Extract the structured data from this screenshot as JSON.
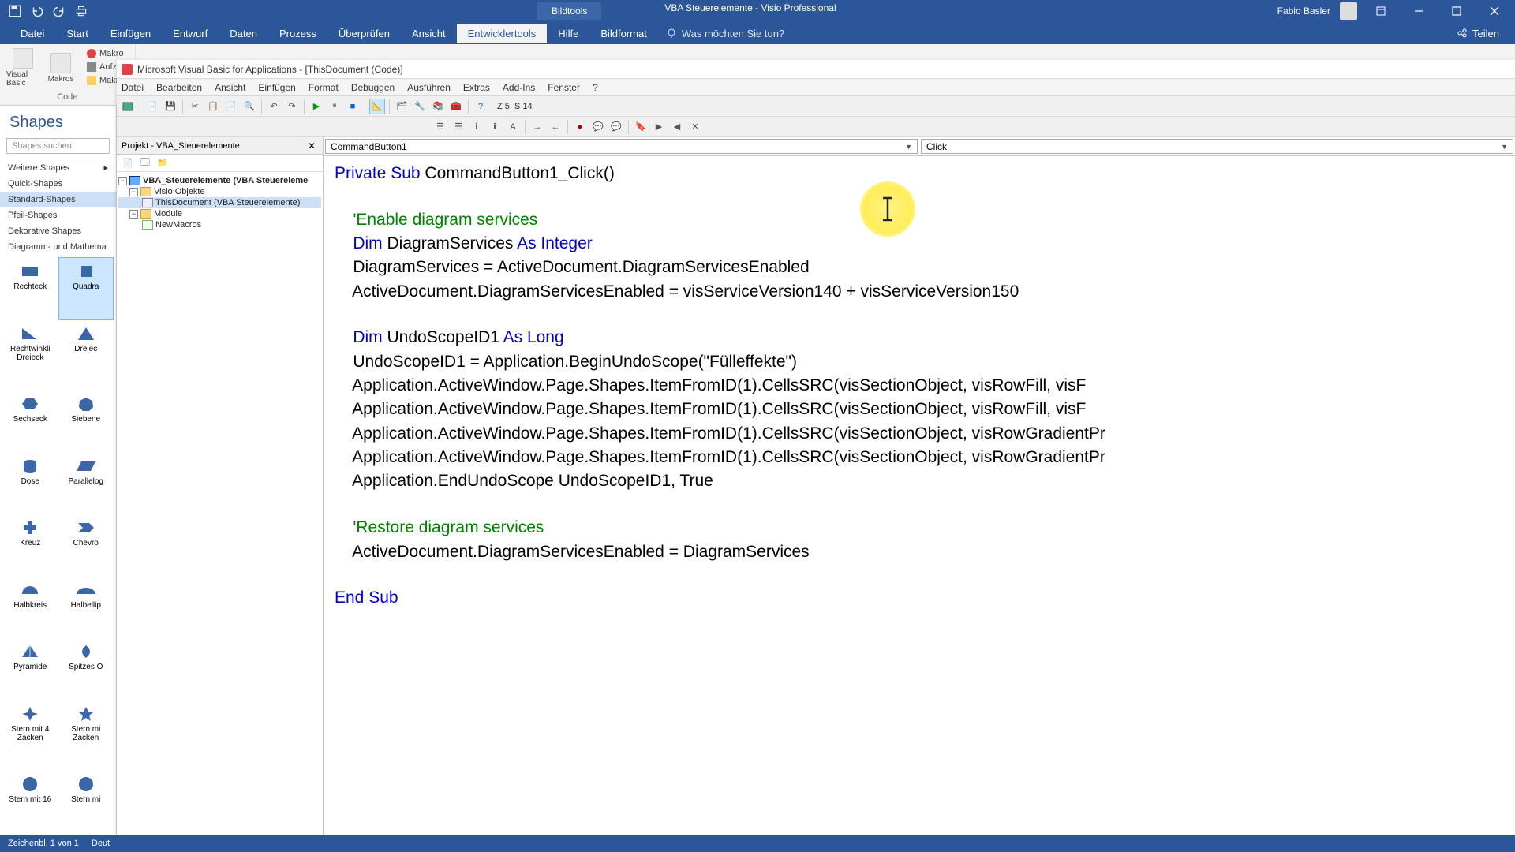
{
  "titlebar": {
    "tool_tab": "Bildtools",
    "doc_title": "VBA Steuerelemente - Visio Professional",
    "user": "Fabio Basler"
  },
  "ribbon": {
    "tabs": [
      "Datei",
      "Start",
      "Einfügen",
      "Entwurf",
      "Daten",
      "Prozess",
      "Überprüfen",
      "Ansicht",
      "Entwicklertools",
      "Hilfe",
      "Bildformat"
    ],
    "active_tab": "Entwicklertools",
    "tellme": "Was möchten Sie tun?",
    "share": "Teilen",
    "group_code": "Code",
    "btn_vb": "Visual Basic",
    "btn_macros": "Makros",
    "btn_makros_rec": "Makro",
    "btn_makros_aufz": "Aufz",
    "btn_makros_sec": "Makro"
  },
  "shapes": {
    "title": "Shapes",
    "search_ph": "Shapes suchen",
    "cats": [
      "Weitere Shapes",
      "Quick-Shapes",
      "Standard-Shapes",
      "Pfeil-Shapes",
      "Dekorative Shapes",
      "Diagramm- und Mathema"
    ],
    "active_cat": 2,
    "items": [
      {
        "n": "Rechteck"
      },
      {
        "n": "Quadra"
      },
      {
        "n": "Rechtwinkli Dreieck"
      },
      {
        "n": "Dreiec"
      },
      {
        "n": "Sechseck"
      },
      {
        "n": "Siebene"
      },
      {
        "n": "Dose"
      },
      {
        "n": "Parallelog"
      },
      {
        "n": "Kreuz"
      },
      {
        "n": "Chevro"
      },
      {
        "n": "Halbkreis"
      },
      {
        "n": "Halbellip"
      },
      {
        "n": "Pyramide"
      },
      {
        "n": "Spitzes O"
      },
      {
        "n": "Stern mit 4 Zacken"
      },
      {
        "n": "Stern mi Zacken"
      },
      {
        "n": "Stern mit 16"
      },
      {
        "n": "Stern mi"
      }
    ]
  },
  "vba": {
    "title": "Microsoft Visual Basic for Applications - [ThisDocument (Code)]",
    "menus": [
      "Datei",
      "Bearbeiten",
      "Ansicht",
      "Einfügen",
      "Format",
      "Debuggen",
      "Ausführen",
      "Extras",
      "Add-Ins",
      "Fenster",
      "?"
    ],
    "pos": "Z 5, S 14",
    "project_title": "Projekt - VBA_Steuerelemente",
    "tree": {
      "root": "VBA_Steuerelemente (VBA Steuereleme",
      "folder1": "Visio Objekte",
      "doc": "ThisDocument (VBA Steuerelemente)",
      "folder2": "Module",
      "mod": "NewMacros"
    },
    "dd_object": "CommandButton1",
    "dd_proc": "Click",
    "code": {
      "l1a": "Private Sub",
      "l1b": " CommandButton1_Click()",
      "l3": "    'Enable diagram services",
      "l4a": "    Dim",
      "l4b": " DiagramServices ",
      "l4c": "As Integer",
      "l5": "    DiagramServices = ActiveDocument.DiagramServicesEnabled",
      "l6": "    ActiveDocument.DiagramServicesEnabled = visServiceVersion140 + visServiceVersion150",
      "l8a": "    Dim",
      "l8b": " UndoScopeID1 ",
      "l8c": "As Long",
      "l9": "    UndoScopeID1 = Application.BeginUndoScope(\"Fülleffekte\")",
      "l10": "    Application.ActiveWindow.Page.Shapes.ItemFromID(1).CellsSRC(visSectionObject, visRowFill, visF",
      "l11": "    Application.ActiveWindow.Page.Shapes.ItemFromID(1).CellsSRC(visSectionObject, visRowFill, visF",
      "l12": "    Application.ActiveWindow.Page.Shapes.ItemFromID(1).CellsSRC(visSectionObject, visRowGradientPr",
      "l13": "    Application.ActiveWindow.Page.Shapes.ItemFromID(1).CellsSRC(visSectionObject, visRowGradientPr",
      "l14": "    Application.EndUndoScope UndoScopeID1, True",
      "l16": "    'Restore diagram services",
      "l17": "    ActiveDocument.DiagramServicesEnabled = DiagramServices",
      "l19": "End Sub"
    }
  },
  "status": {
    "left1": "Zeichenbl. 1 von 1",
    "left2": "Deut"
  }
}
